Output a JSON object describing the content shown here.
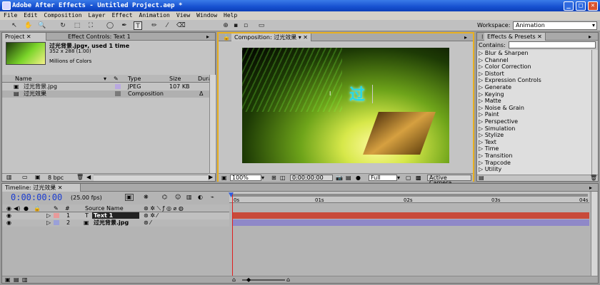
{
  "window": {
    "title": "Adobe After Effects - Untitled Project.aep *",
    "min": "_",
    "max": "□",
    "close": "✕"
  },
  "menu": [
    "File",
    "Edit",
    "Composition",
    "Layer",
    "Effect",
    "Animation",
    "View",
    "Window",
    "Help"
  ],
  "toolbar": {
    "tools": [
      "↖",
      "✋",
      "🔍",
      "↻",
      "⬚",
      "⛶",
      "◯",
      "✒",
      "T",
      "✏",
      "⁄",
      "⌫"
    ],
    "workspace_label": "Workspace:",
    "workspace_value": "Animation"
  },
  "project_panel": {
    "tab_project": "Project",
    "tab_effect_controls": "Effect Controls: Text 1",
    "selected_file": "过光背景.jpg",
    "used_text": "▾, used 1 time",
    "dimensions": "352 x 288 (1.00)",
    "color_info": "Millions of Colors",
    "columns": {
      "name": "Name",
      "type": "Type",
      "size": "Size",
      "duration": "Durat"
    },
    "items": [
      {
        "name": "过光背景.jpg",
        "type": "JPEG",
        "size": "107 KB",
        "label_color": "#b9a8e0",
        "duration": ""
      },
      {
        "name": "过光效果",
        "type": "Composition",
        "size": "",
        "label_color": "#7a7a7a",
        "duration": "Δ"
      }
    ],
    "bpc": "8 bpc"
  },
  "composition_panel": {
    "tab": "Composition: 过光效果",
    "zoom": "100%",
    "timecode": "0:00:00:00",
    "resolution": "Full",
    "camera": "Active Camera",
    "canvas_text": "过"
  },
  "effects_panel": {
    "tab": "Effects & Presets",
    "contains_label": "Contains:",
    "items": [
      "Blur & Sharpen",
      "Channel",
      "Color Correction",
      "Distort",
      "Expression Controls",
      "Generate",
      "Keying",
      "Matte",
      "Noise & Grain",
      "Paint",
      "Perspective",
      "Simulation",
      "Stylize",
      "Text",
      "Time",
      "Transition",
      "Trapcode",
      "Utility"
    ]
  },
  "timeline": {
    "tab": "Timeline: 过光效果",
    "timecode": "0:00:00:00",
    "fps": "(25.00 fps)",
    "col_number": "#",
    "col_source": "Source Name",
    "ruler": [
      "0s",
      "01s",
      "02s",
      "03s",
      "04s"
    ],
    "layers": [
      {
        "num": "1",
        "name": "Text 1",
        "type_icon": "T",
        "color": "#e89a9a",
        "bar_color": "#c84a3a"
      },
      {
        "num": "2",
        "name": "过光背景.jpg",
        "type_icon": "▣",
        "color": "#9aa0d8",
        "bar_color": "#8f88c8"
      }
    ]
  }
}
